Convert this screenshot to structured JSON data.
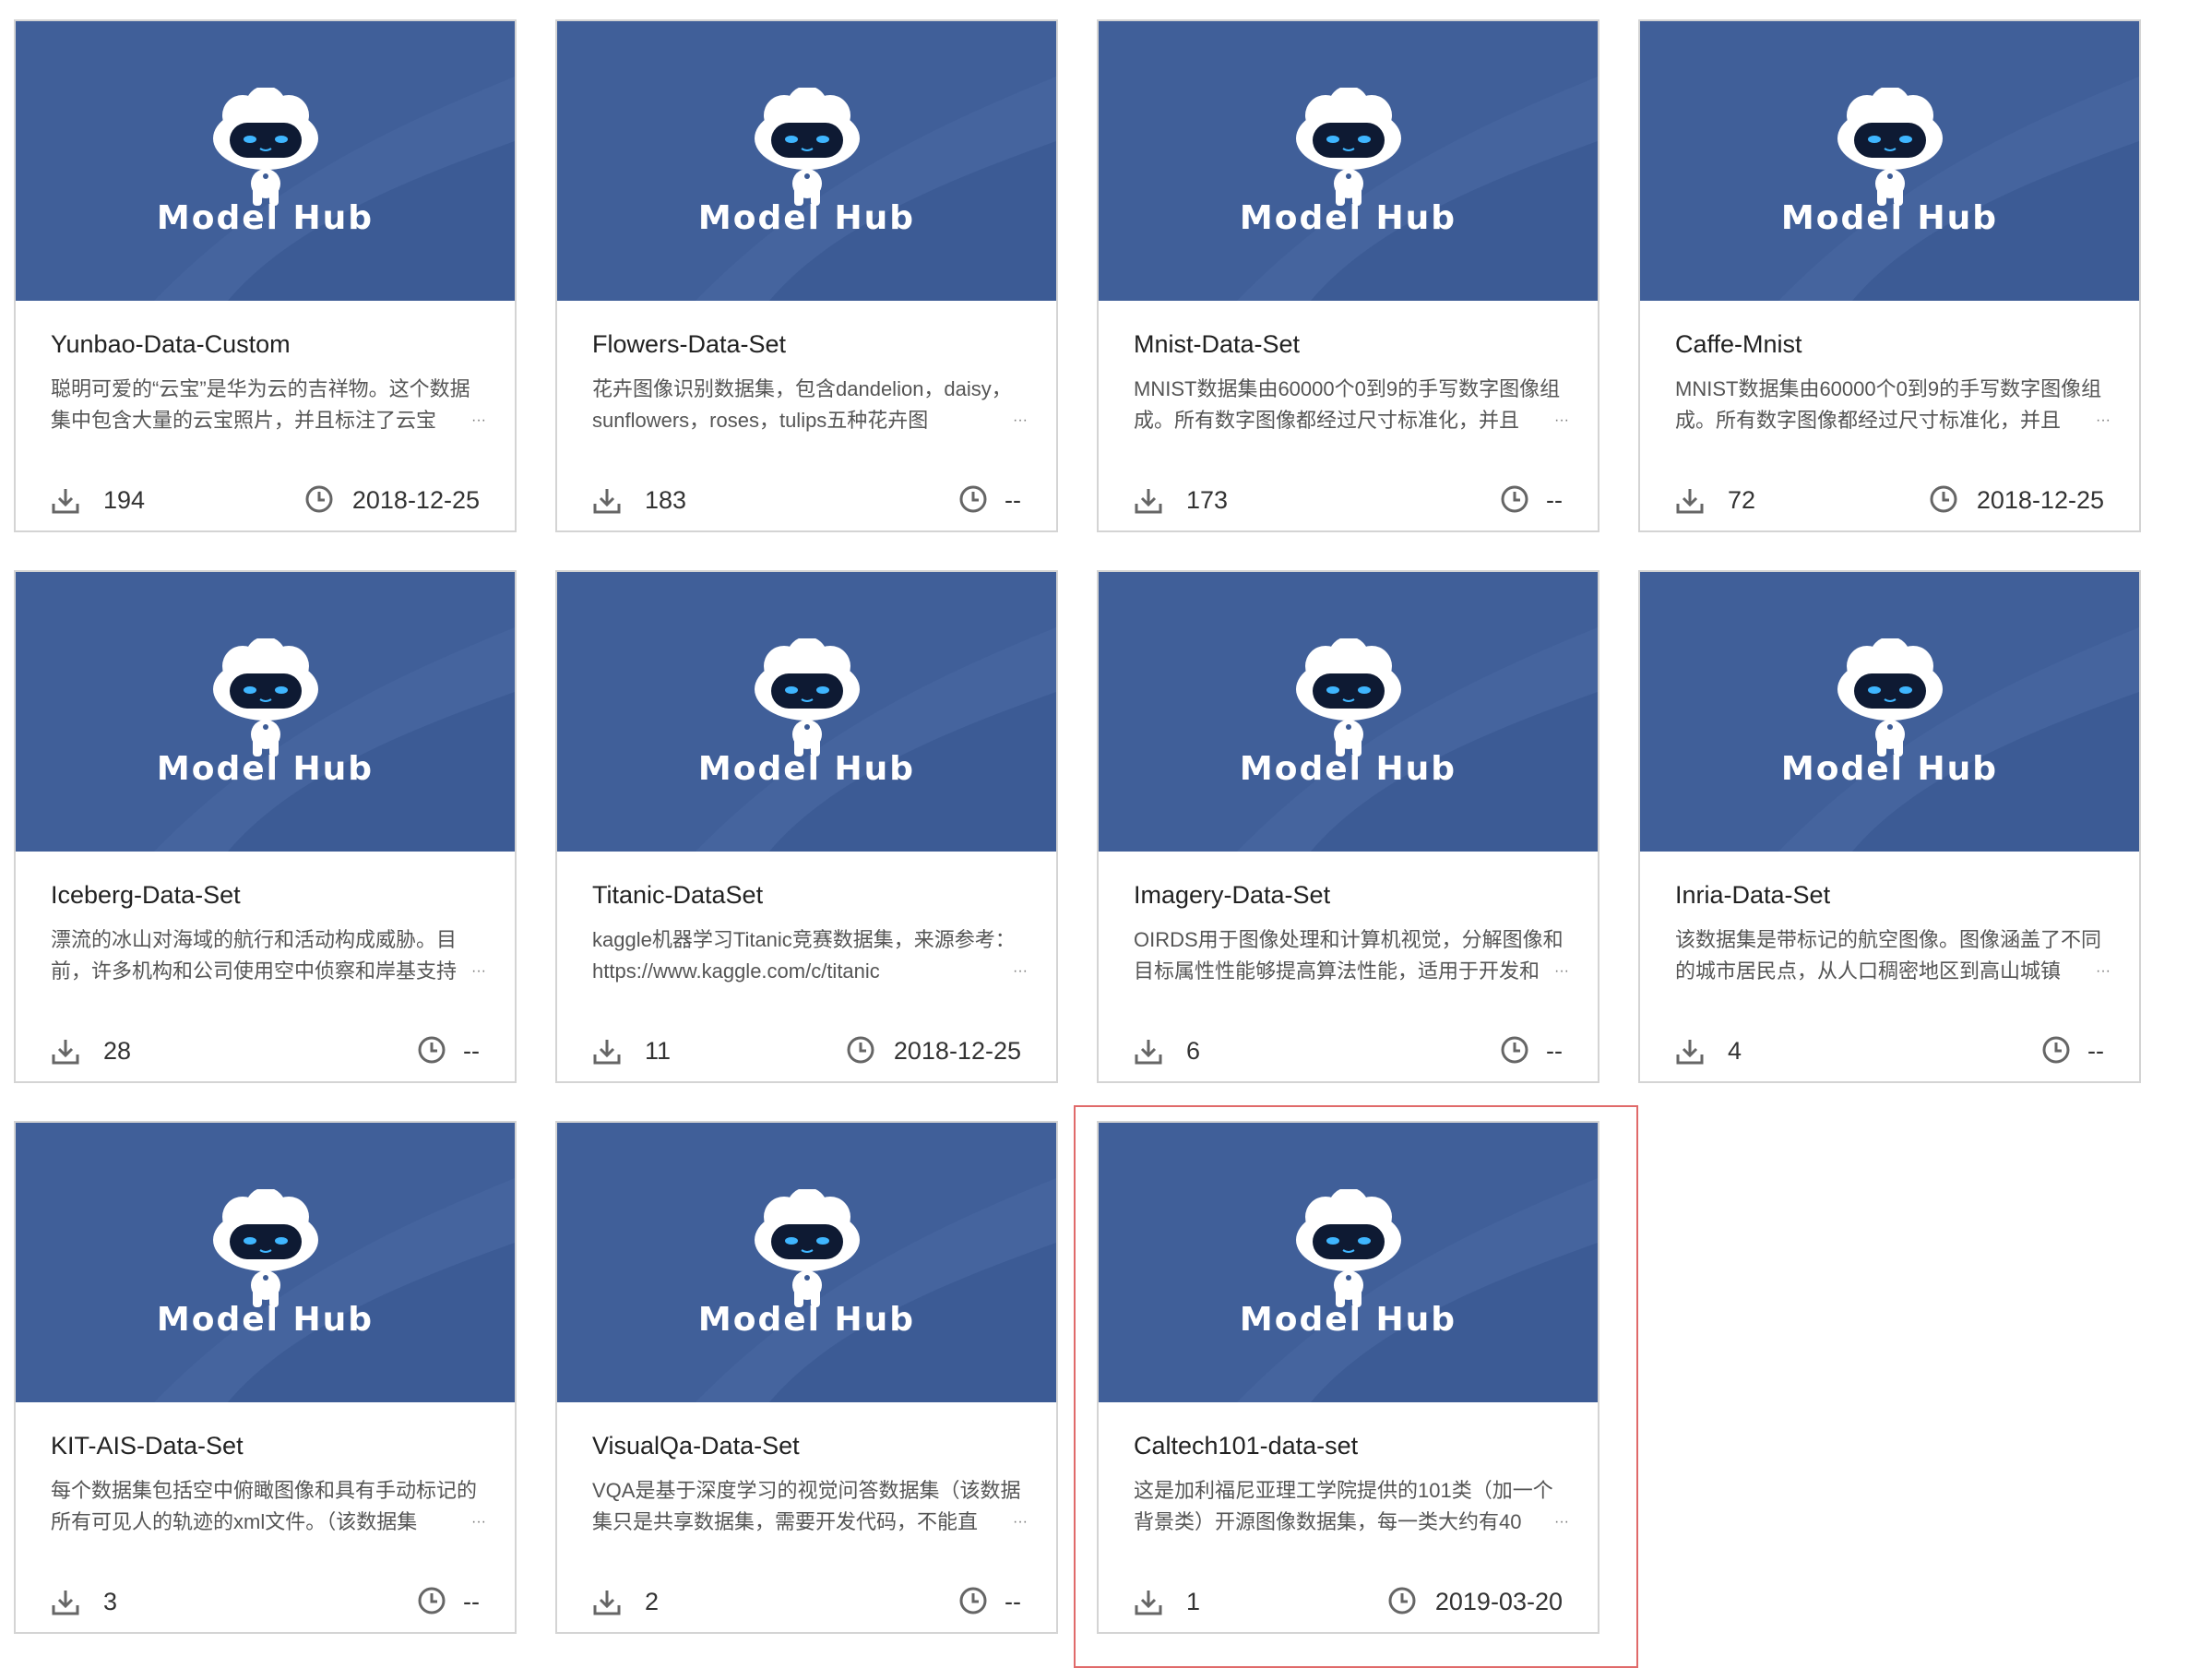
{
  "logo_text": "Model Hub",
  "colors": {
    "banner": "#3c5b95",
    "banner_light": "#4f6fa8",
    "selection": "#e06a6a",
    "icon": "#666666"
  },
  "icons": {
    "download": "download-icon",
    "time": "clock-icon",
    "mascot": "robot-mascot-icon"
  },
  "selected_card": "Caltech101-data-set",
  "datasets": [
    {
      "title": "Yunbao-Data-Custom",
      "desc": "聪明可爱的“云宝”是华为云的吉祥物。这个数据集中包含大量的云宝照片，并且标注了云宝",
      "downloads": "194",
      "date": "2018-12-25"
    },
    {
      "title": "Flowers-Data-Set",
      "desc": "花卉图像识别数据集，包含dandelion，daisy，sunflowers，roses，tulips五种花卉图",
      "downloads": "183",
      "date": "--"
    },
    {
      "title": "Mnist-Data-Set",
      "desc": "MNIST数据集由60000个0到9的手写数字图像组成。所有数字图像都经过尺寸标准化，并且",
      "downloads": "173",
      "date": "--"
    },
    {
      "title": "Caffe-Mnist",
      "desc": "MNIST数据集由60000个0到9的手写数字图像组成。所有数字图像都经过尺寸标准化，并且",
      "downloads": "72",
      "date": "2018-12-25"
    },
    {
      "title": "Iceberg-Data-Set",
      "desc": "漂流的冰山对海域的航行和活动构成威胁。目前，许多机构和公司使用空中侦察和岸基支持",
      "downloads": "28",
      "date": "--"
    },
    {
      "title": "Titanic-DataSet",
      "desc": "kaggle机器学习Titanic竞赛数据集，来源参考：https://www.kaggle.com/c/titanic",
      "downloads": "11",
      "date": "2018-12-25"
    },
    {
      "title": "Imagery-Data-Set",
      "desc": "OIRDS用于图像处理和计算机视觉，分解图像和目标属性性能够提高算法性能，适用于开发和",
      "downloads": "6",
      "date": "--"
    },
    {
      "title": "Inria-Data-Set",
      "desc": "该数据集是带标记的航空图像。图像涵盖了不同的城市居民点，从人口稠密地区到高山城镇",
      "downloads": "4",
      "date": "--"
    },
    {
      "title": "KIT-AIS-Data-Set",
      "desc": "每个数据集包括空中俯瞰图像和具有手动标记的所有可见人的轨迹的xml文件。（该数据集",
      "downloads": "3",
      "date": "--"
    },
    {
      "title": "VisualQa-Data-Set",
      "desc": "VQA是基于深度学习的视觉问答数据集（该数据集只是共享数据集，需要开发代码，不能直",
      "downloads": "2",
      "date": "--"
    },
    {
      "title": "Caltech101-data-set",
      "desc": "这是加利福尼亚理工学院提供的101类（加一个背景类）开源图像数据集，每一类大约有40",
      "downloads": "1",
      "date": "2019-03-20"
    }
  ]
}
